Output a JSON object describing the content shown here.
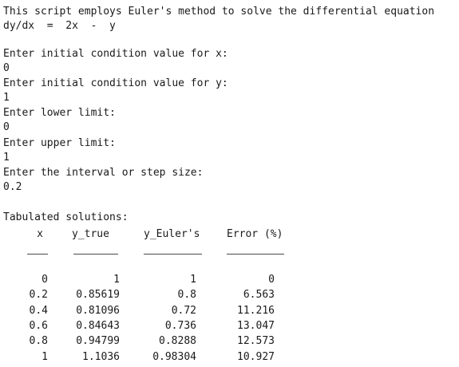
{
  "intro": {
    "line1": "This script employs Euler's method to solve the differential equation",
    "line2": "dy/dx  =  2x  -  y"
  },
  "prompts": [
    {
      "label": "Enter initial condition value for x:",
      "value": "0"
    },
    {
      "label": "Enter initial condition value for y:",
      "value": "1"
    },
    {
      "label": "Enter lower limit:",
      "value": "0"
    },
    {
      "label": "Enter upper limit:",
      "value": "1"
    },
    {
      "label": "Enter the interval or step size:",
      "value": "0.2"
    }
  ],
  "table": {
    "title": "Tabulated solutions:",
    "headers": [
      "x",
      "y_true",
      "y_Euler's",
      "Error (%)"
    ],
    "rows": [
      [
        "0",
        "1",
        "1",
        "0"
      ],
      [
        "0.2",
        "0.85619",
        "0.8",
        "6.563"
      ],
      [
        "0.4",
        "0.81096",
        "0.72",
        "11.216"
      ],
      [
        "0.6",
        "0.84643",
        "0.736",
        "13.047"
      ],
      [
        "0.8",
        "0.94799",
        "0.8288",
        "12.573"
      ],
      [
        "1",
        "1.1036",
        "0.98304",
        "10.927"
      ]
    ]
  }
}
